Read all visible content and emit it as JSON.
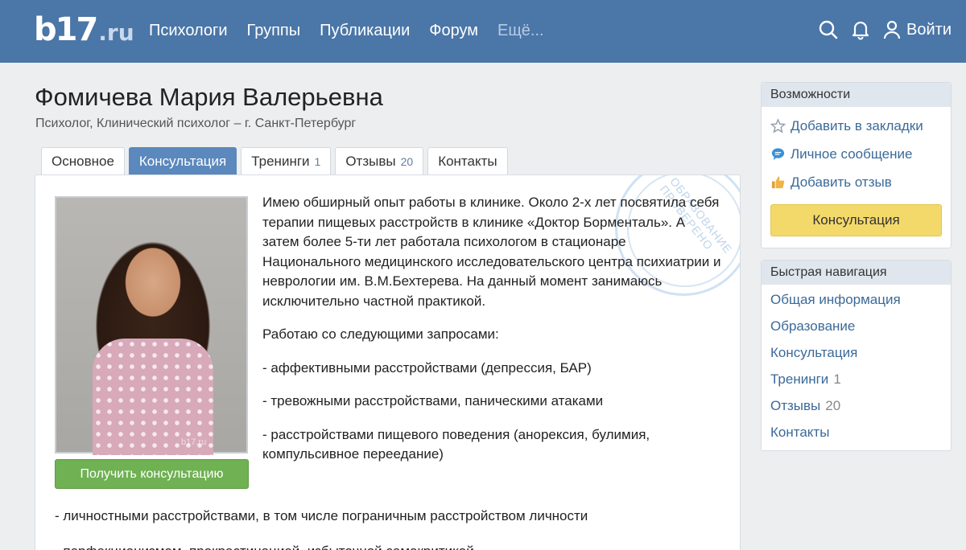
{
  "header": {
    "logo_main": "b17",
    "logo_tld": ".ru",
    "nav": [
      "Психологи",
      "Группы",
      "Публикации",
      "Форум"
    ],
    "nav_more": "Ещё...",
    "login": "Войти"
  },
  "profile": {
    "name": "Фомичева Мария Валерьевна",
    "subtitle": "Психолог, Клинический психолог – г. Санкт-Петербург"
  },
  "tabs": [
    {
      "label": "Основное",
      "count": ""
    },
    {
      "label": "Консультация",
      "count": ""
    },
    {
      "label": "Тренинги",
      "count": "1"
    },
    {
      "label": "Отзывы",
      "count": "20"
    },
    {
      "label": "Контакты",
      "count": ""
    }
  ],
  "main": {
    "photo_watermark": "b17.ru",
    "get_consult_button": "Получить консультацию",
    "stamp_text": "ОБРАЗОВАНИЕ ПРОВЕРЕНО",
    "paragraph1": "Имею обширный опыт работы в клинике. Около 2-х лет посвятила себя терапии пищевых расстройств в клинике «Доктор Борменталь». А затем более 5-ти лет работала психологом в стационаре Национального медицинского исследовательского центра психиатрии и неврологии им. В.М.Бехтерева. На данный момент занимаюсь исключительно частной практикой.",
    "paragraph2": "Работаю со следующими запросами:",
    "item1": "- аффективными расстройствами (депрессия, БАР)",
    "item2": "- тревожными расстройствами, паническими атаками",
    "item3": "- расстройствами пищевого поведения (анорексия, булимия, компульсивное переедание)",
    "item4": "- личностными расстройствами, в том числе пограничным расстройством личности",
    "item5": "- перфекционизмом, прокрастинацией, избыточной самокритикой"
  },
  "sidebar": {
    "features_title": "Возможности",
    "bookmark": "Добавить в закладки",
    "message": "Личное сообщение",
    "review": "Добавить отзыв",
    "consult_button": "Консультация",
    "nav_title": "Быстрая навигация",
    "nav_items": [
      {
        "label": "Общая информация",
        "count": ""
      },
      {
        "label": "Образование",
        "count": ""
      },
      {
        "label": "Консультация",
        "count": ""
      },
      {
        "label": "Тренинги",
        "count": "1"
      },
      {
        "label": "Отзывы",
        "count": "20"
      },
      {
        "label": "Контакты",
        "count": ""
      }
    ]
  },
  "colors": {
    "header": "#4a76a8",
    "active_tab": "#5b88bd",
    "green_button": "#6fb153",
    "yellow_button": "#f3d96a",
    "link": "#3b6a99"
  },
  "icons": [
    "search-icon",
    "bell-icon",
    "user-icon",
    "star-icon",
    "chat-icon",
    "thumbs-up-icon"
  ]
}
